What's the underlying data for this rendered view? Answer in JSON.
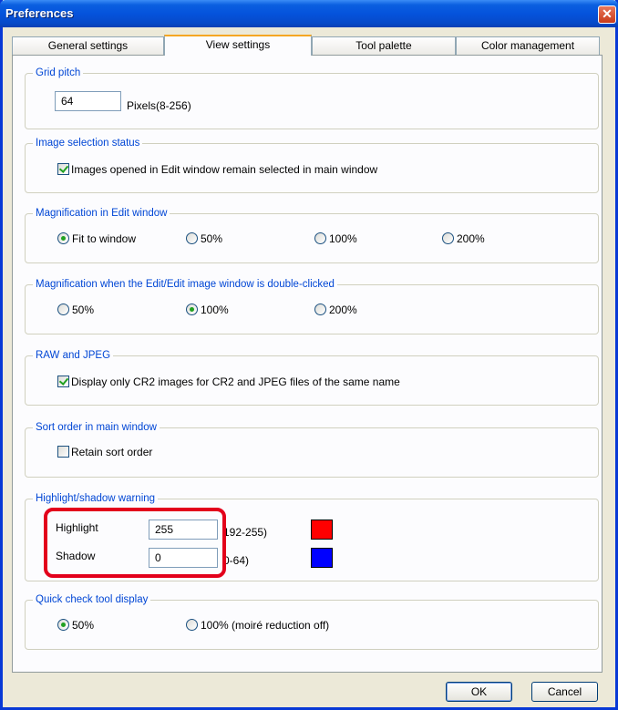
{
  "window": {
    "title": "Preferences",
    "close_glyph": "✕"
  },
  "tabs": [
    {
      "label": "General settings",
      "active": false
    },
    {
      "label": "View settings",
      "active": true
    },
    {
      "label": "Tool palette",
      "active": false
    },
    {
      "label": "Color management",
      "active": false
    }
  ],
  "grid_pitch": {
    "title": "Grid pitch",
    "value": "64",
    "unit": "Pixels(8-256)"
  },
  "image_selection": {
    "title": "Image selection status",
    "checkbox_label": "Images opened in Edit window remain selected in main window",
    "checked": true
  },
  "magnification_edit": {
    "title": "Magnification in Edit window",
    "options": [
      "Fit to window",
      "50%",
      "100%",
      "200%"
    ],
    "selected": "Fit to window"
  },
  "magnification_dblclick": {
    "title": "Magnification when the Edit/Edit image window is double-clicked",
    "options": [
      "50%",
      "100%",
      "200%"
    ],
    "selected": "100%"
  },
  "raw_jpeg": {
    "title": "RAW and JPEG",
    "checkbox_label": "Display only CR2 images for CR2 and JPEG files of the same name",
    "checked": true
  },
  "sort_order": {
    "title": "Sort order in main window",
    "checkbox_label": "Retain sort order",
    "checked": false
  },
  "highlight_shadow": {
    "title": "Highlight/shadow warning",
    "highlight_label": "Highlight",
    "highlight_value": "255",
    "highlight_range": "192-255)",
    "highlight_color": "#ff0000",
    "shadow_label": "Shadow",
    "shadow_value": "0",
    "shadow_range": "0-64)",
    "shadow_color": "#0000ff"
  },
  "quick_check": {
    "title": "Quick check tool display",
    "options": [
      "50%",
      "100% (moiré reduction off)"
    ],
    "selected": "50%"
  },
  "buttons": {
    "ok": "OK",
    "cancel": "Cancel"
  }
}
